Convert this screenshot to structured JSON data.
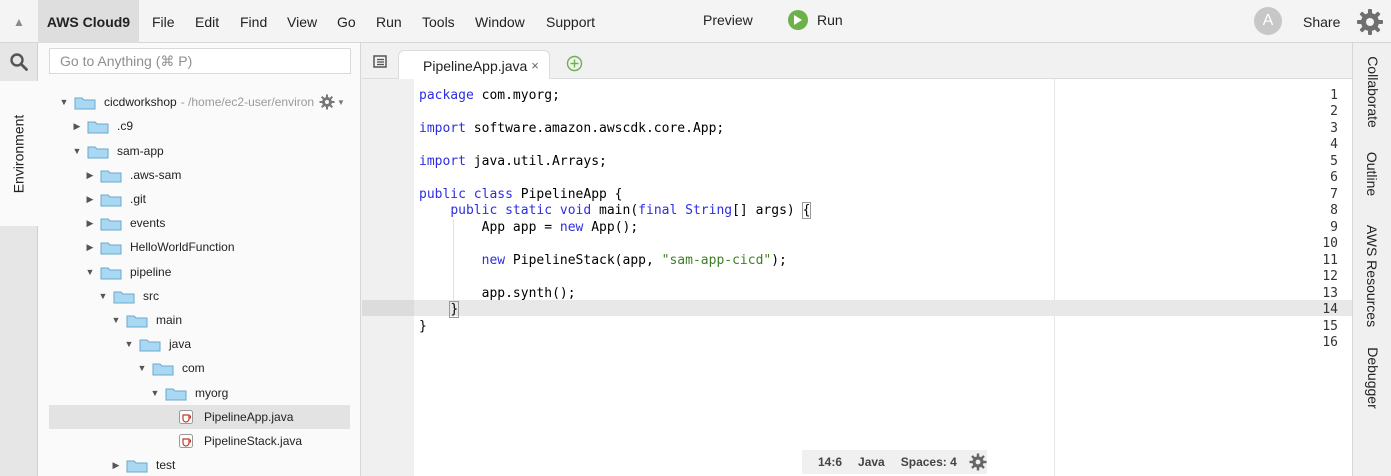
{
  "menubar": {
    "brand": "AWS Cloud9",
    "menus": [
      "File",
      "Edit",
      "Find",
      "View",
      "Go",
      "Run",
      "Tools",
      "Window",
      "Support"
    ],
    "preview_label": "Preview",
    "run_label": "Run",
    "avatar_initial": "A",
    "share_label": "Share"
  },
  "leftbar": {
    "environment_tab": "Environment"
  },
  "tree": {
    "search_placeholder": "Go to Anything (⌘ P)",
    "root": {
      "name": "cicdworkshop",
      "path": "- /home/ec2-user/environ"
    },
    "nodes": [
      {
        "name": ".c9",
        "expanded": false
      },
      {
        "name": "sam-app",
        "expanded": true
      },
      {
        "name": ".aws-sam",
        "expanded": false
      },
      {
        "name": ".git",
        "expanded": false
      },
      {
        "name": "events",
        "expanded": false
      },
      {
        "name": "HelloWorldFunction",
        "expanded": false
      },
      {
        "name": "pipeline",
        "expanded": true
      },
      {
        "name": "src",
        "expanded": true
      },
      {
        "name": "main",
        "expanded": true
      },
      {
        "name": "java",
        "expanded": true
      },
      {
        "name": "com",
        "expanded": true
      },
      {
        "name": "myorg",
        "expanded": true
      },
      {
        "name": "PipelineApp.java",
        "type": "file",
        "selected": true
      },
      {
        "name": "PipelineStack.java",
        "type": "file"
      },
      {
        "name": "test",
        "expanded": false
      }
    ]
  },
  "editor": {
    "tab_label": "PipelineApp.java",
    "tab_close": "×",
    "line_numbers": [
      "1",
      "2",
      "3",
      "4",
      "5",
      "6",
      "7",
      "8",
      "9",
      "10",
      "11",
      "12",
      "13",
      "14",
      "15",
      "16"
    ],
    "active_line": 14,
    "code": {
      "l1_kw": "package",
      "l1_rest": " com.myorg;",
      "l3_kw": "import",
      "l3_rest": " software.amazon.awscdk.core.App;",
      "l5_kw": "import",
      "l5_rest": " java.util.Arrays;",
      "l7_kw": "public class",
      "l7_rest": " PipelineApp {",
      "l8_indent": "    ",
      "l8_kw1": "public static void",
      "l8_mid": " main(",
      "l8_kw2": "final",
      "l8_type": " String",
      "l8_rest": "[] args) ",
      "l8_brace": "{",
      "l9_indent": "        ",
      "l9_pre": "App app = ",
      "l9_kw": "new",
      "l9_rest": " App();",
      "l11_indent": "        ",
      "l11_kw": "new",
      "l11_mid": " PipelineStack(app, ",
      "l11_str": "\"sam-app-cicd\"",
      "l11_rest": ");",
      "l13_indent": "        ",
      "l13_rest": "app.synth();",
      "l14_indent": "    ",
      "l14_brace": "}",
      "l15_rest": "}"
    }
  },
  "statusbar": {
    "cursor": "14:6",
    "language": "Java",
    "spaces": "Spaces: 4"
  },
  "rightbar": {
    "tabs": [
      "Collaborate",
      "Outline",
      "AWS Resources",
      "Debugger"
    ]
  },
  "colors": {
    "keyword": "#2e2ee0",
    "string": "#3f7f23",
    "run_green": "#6cb14a",
    "folder_blue": "#a9d8f3"
  }
}
